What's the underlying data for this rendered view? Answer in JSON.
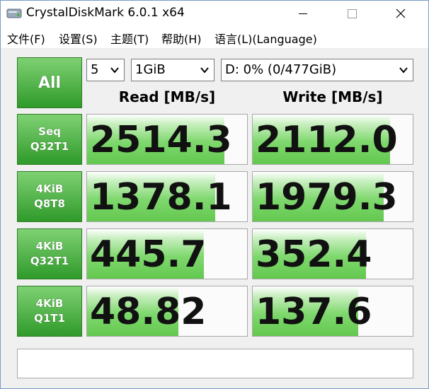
{
  "window": {
    "title": "CrystalDiskMark 6.0.1 x64"
  },
  "menu": {
    "items": [
      "文件(F)",
      "设置(S)",
      "主题(T)",
      "帮助(H)",
      "语言(L)(Language)"
    ]
  },
  "controls": {
    "all_label": "All",
    "count_value": "5",
    "size_value": "1GiB",
    "drive_value": "D: 0% (0/477GiB)"
  },
  "headers": {
    "read": "Read [MB/s]",
    "write": "Write [MB/s]"
  },
  "tests": [
    {
      "line1": "Seq",
      "line2": "Q32T1",
      "read": "2514.3",
      "write": "2112.0",
      "read_fill": 0.86,
      "write_fill": 0.86
    },
    {
      "line1": "4KiB",
      "line2": "Q8T8",
      "read": "1378.1",
      "write": "1979.3",
      "read_fill": 0.8,
      "write_fill": 0.82
    },
    {
      "line1": "4KiB",
      "line2": "Q32T1",
      "read": "445.7",
      "write": "352.4",
      "read_fill": 0.73,
      "write_fill": 0.71
    },
    {
      "line1": "4KiB",
      "line2": "Q1T1",
      "read": "48.82",
      "write": "137.6",
      "read_fill": 0.57,
      "write_fill": 0.66
    }
  ],
  "colors": {
    "accent_green": "#2f9a2a",
    "bar_green": "#63c84f"
  }
}
